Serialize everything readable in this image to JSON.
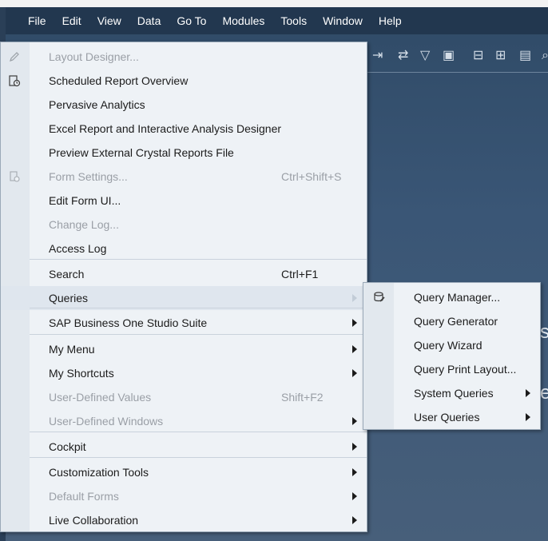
{
  "menubar": {
    "items": [
      "File",
      "Edit",
      "View",
      "Data",
      "Go To",
      "Modules",
      "Tools",
      "Window",
      "Help"
    ]
  },
  "background_text": {
    "line1": "s",
    "line2": "e"
  },
  "menu": {
    "items": [
      {
        "label": "Layout Designer...",
        "shortcut": "",
        "disabled": true,
        "submenu": false,
        "icon": "pencil-icon"
      },
      {
        "label": "Scheduled Report Overview",
        "shortcut": "",
        "disabled": false,
        "submenu": false,
        "icon": "report-clock-icon"
      },
      {
        "label": "Pervasive Analytics",
        "shortcut": "",
        "disabled": false,
        "submenu": false,
        "icon": ""
      },
      {
        "label": "Excel Report and Interactive Analysis Designer",
        "shortcut": "",
        "disabled": false,
        "submenu": false,
        "icon": ""
      },
      {
        "label": "Preview External Crystal Reports File",
        "shortcut": "",
        "disabled": false,
        "submenu": false,
        "icon": ""
      },
      {
        "label": "Form Settings...",
        "shortcut": "Ctrl+Shift+S",
        "disabled": true,
        "submenu": false,
        "icon": "form-settings-icon"
      },
      {
        "label": "Edit Form UI...",
        "shortcut": "",
        "disabled": false,
        "submenu": false,
        "icon": ""
      },
      {
        "label": "Change Log...",
        "shortcut": "",
        "disabled": true,
        "submenu": false,
        "icon": ""
      },
      {
        "label": "Access Log",
        "shortcut": "",
        "disabled": false,
        "submenu": false,
        "icon": ""
      },
      {
        "label": "Search",
        "shortcut": "Ctrl+F1",
        "disabled": false,
        "submenu": false,
        "icon": ""
      },
      {
        "label": "Queries",
        "shortcut": "",
        "disabled": false,
        "submenu": true,
        "icon": ""
      },
      {
        "label": "SAP Business One Studio Suite",
        "shortcut": "",
        "disabled": false,
        "submenu": true,
        "icon": ""
      },
      {
        "label": "My Menu",
        "shortcut": "",
        "disabled": false,
        "submenu": true,
        "icon": ""
      },
      {
        "label": "My Shortcuts",
        "shortcut": "",
        "disabled": false,
        "submenu": true,
        "icon": ""
      },
      {
        "label": "User-Defined Values",
        "shortcut": "Shift+F2",
        "disabled": true,
        "submenu": false,
        "icon": ""
      },
      {
        "label": "User-Defined Windows",
        "shortcut": "",
        "disabled": true,
        "submenu": true,
        "icon": ""
      },
      {
        "label": "Cockpit",
        "shortcut": "",
        "disabled": false,
        "submenu": true,
        "icon": ""
      },
      {
        "label": "Customization Tools",
        "shortcut": "",
        "disabled": false,
        "submenu": true,
        "icon": ""
      },
      {
        "label": "Default Forms",
        "shortcut": "",
        "disabled": true,
        "submenu": true,
        "icon": ""
      },
      {
        "label": "Live Collaboration",
        "shortcut": "",
        "disabled": false,
        "submenu": true,
        "icon": ""
      }
    ]
  },
  "submenu": {
    "items": [
      {
        "label": "Query Manager...",
        "submenu": false,
        "icon": "query-manager-icon"
      },
      {
        "label": "Query Generator",
        "submenu": false,
        "icon": ""
      },
      {
        "label": "Query Wizard",
        "submenu": false,
        "icon": ""
      },
      {
        "label": "Query Print Layout...",
        "submenu": false,
        "icon": ""
      },
      {
        "label": "System Queries",
        "submenu": true,
        "icon": ""
      },
      {
        "label": "User Queries",
        "submenu": true,
        "icon": ""
      }
    ]
  },
  "colors": {
    "menubar_bg": "#22374f",
    "menu_bg": "#eef2f6",
    "highlight": "#dfe6ee",
    "disabled_text": "#9a9fa6"
  }
}
